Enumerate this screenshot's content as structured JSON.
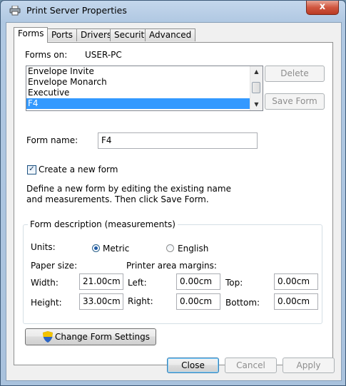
{
  "window": {
    "title": "Print Server Properties",
    "close_glyph": "x"
  },
  "tabs": [
    {
      "label": "Forms",
      "active": true
    },
    {
      "label": "Ports",
      "active": false
    },
    {
      "label": "Drivers",
      "active": false
    },
    {
      "label": "Security",
      "active": false
    },
    {
      "label": "Advanced",
      "active": false
    }
  ],
  "forms_on": {
    "label": "Forms on:",
    "value": "USER-PC"
  },
  "forms_list": [
    "Envelope Invite",
    "Envelope Monarch",
    "Executive",
    "F4"
  ],
  "side_buttons": {
    "delete": "Delete",
    "save_form": "Save Form"
  },
  "form_name": {
    "label": "Form name:",
    "value": "F4"
  },
  "create_new": {
    "label": "Create a new form",
    "checked": true
  },
  "description": "Define a new form by editing the existing name and measurements. Then click Save Form.",
  "group": {
    "title": "Form description (measurements)",
    "units_label": "Units:",
    "metric": "Metric",
    "english": "English",
    "paper_size_label": "Paper size:",
    "margins_label": "Printer area margins:",
    "width_label": "Width:",
    "width_value": "21.00cm",
    "height_label": "Height:",
    "height_value": "33.00cm",
    "left_label": "Left:",
    "left_value": "0.00cm",
    "right_label": "Right:",
    "right_value": "0.00cm",
    "top_label": "Top:",
    "top_value": "0.00cm",
    "bottom_label": "Bottom:",
    "bottom_value": "0.00cm"
  },
  "change_settings": "Change Form Settings",
  "footer": {
    "close": "Close",
    "cancel": "Cancel",
    "apply": "Apply"
  },
  "colors": {
    "selection": "#3399ff",
    "titlebar": "#b0c8e2",
    "close_button": "#d0563f"
  },
  "icons": {
    "title": "printer-icon",
    "change_settings": "uac-shield-icon"
  }
}
